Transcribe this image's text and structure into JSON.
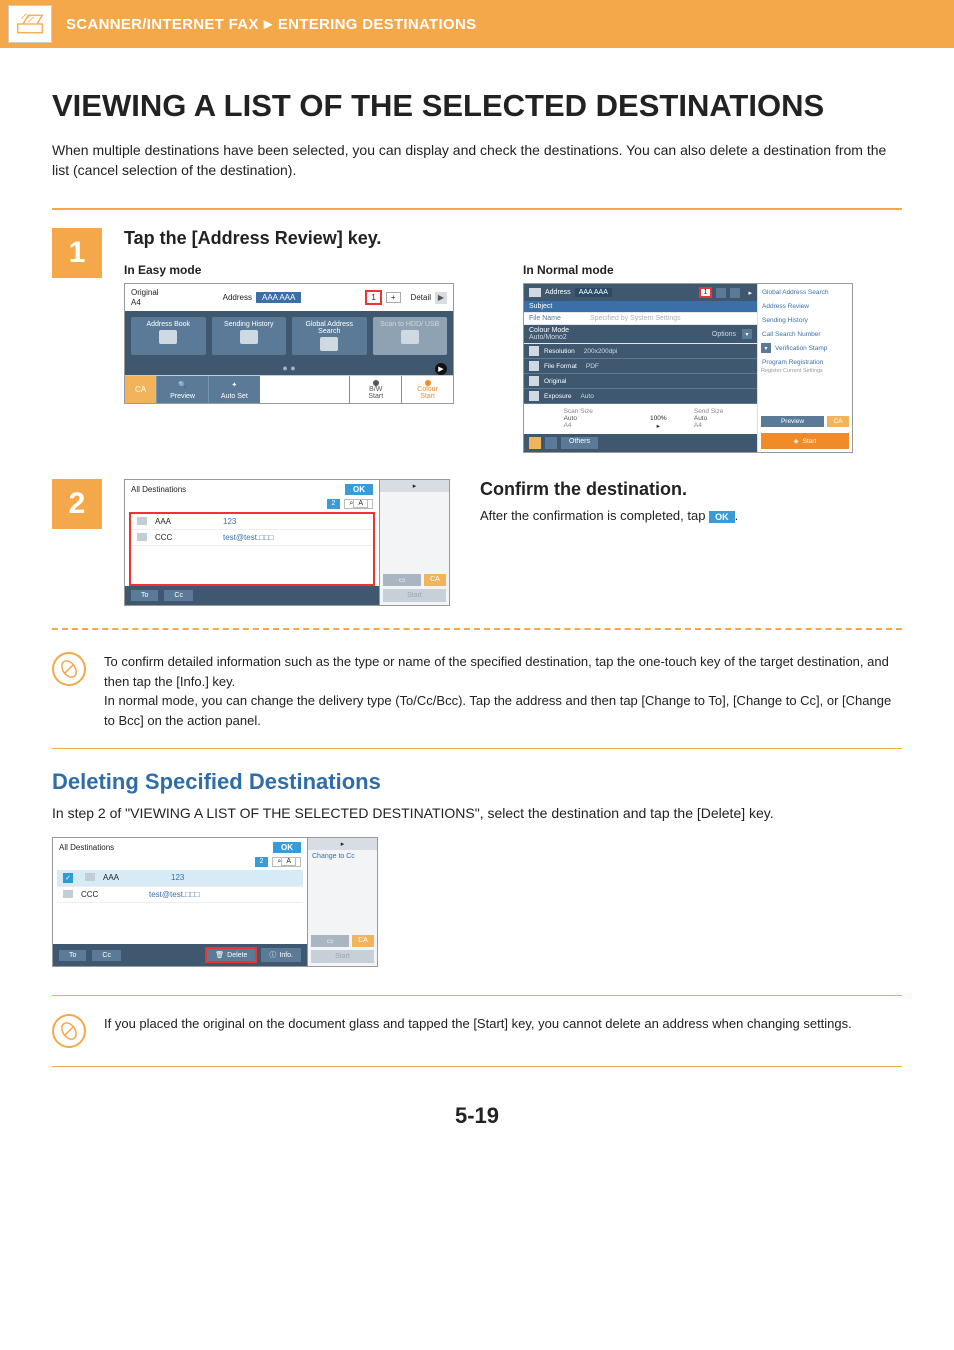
{
  "header": {
    "section": "SCANNER/INTERNET FAX",
    "subsection": "ENTERING DESTINATIONS"
  },
  "title": "VIEWING A LIST OF THE SELECTED DESTINATIONS",
  "intro": "When multiple destinations have been selected, you can display and check the destinations. You can also delete a destination from the list (cancel selection of the destination).",
  "step1": {
    "num": "1",
    "heading": "Tap the [Address Review] key.",
    "easy_label": "In Easy mode",
    "normal_label": "In Normal mode",
    "easy": {
      "original_label": "Original",
      "original_size": "A4",
      "address_label": "Address",
      "address_value": "AAA AAA",
      "count": "1",
      "plus": "+",
      "detail": "Detail",
      "btn_addressbook": "Address Book",
      "btn_history": "Sending History",
      "btn_global": "Global Address Search",
      "btn_usb": "Scan to HDD/ USB",
      "ca": "CA",
      "preview": "Preview",
      "autoset": "Auto Set",
      "bw": "B/W",
      "bw_start": "Start",
      "colour": "Colour",
      "colour_start": "Start"
    },
    "normal": {
      "address_label": "Address",
      "address_value": "AAA AAA",
      "count": "1",
      "subject": "Subject",
      "filename": "File Name",
      "filename_val": "Specified by System Settings",
      "colourmode": "Colour Mode",
      "colourmode_val": "Auto/Mono2",
      "options": "Options",
      "resolution": "Resolution",
      "resolution_val": "200x200dpi",
      "fileformat": "File Format",
      "fileformat_val": "PDF",
      "original": "Original",
      "exposure": "Exposure",
      "exposure_val": "Auto",
      "others": "Others",
      "scansize": "Scan Size",
      "scansize_val": "Auto",
      "scansize_fmt": "A4",
      "zoom": "100%",
      "sendsize": "Send Size",
      "sendsize_val": "Auto",
      "sendsize_fmt": "A4",
      "right_global": "Global Address Search",
      "right_review": "Address Review",
      "right_history": "Sending History",
      "right_call": "Call Search Number",
      "right_verify": "Verification Stamp",
      "right_program": "Program Registration",
      "right_program_sub": "Register Current Settings",
      "preview": "Preview",
      "ca": "CA",
      "start": "Start"
    }
  },
  "step2": {
    "num": "2",
    "all_dest": "All Destinations",
    "ok": "OK",
    "sort_num": "2",
    "sort_alpha": "A",
    "rows": [
      {
        "name": "AAA",
        "value": "123"
      },
      {
        "name": "CCC",
        "value": "test@test.□□□"
      }
    ],
    "to": "To",
    "cc": "Cc",
    "heading": "Confirm the destination.",
    "text_before": "After the confirmation is completed, tap ",
    "text_after": "."
  },
  "note1": "To confirm detailed information such as the type or name of the specified destination, tap the one-touch key of the target destination, and then tap the [Info.] key.\nIn normal mode, you can change the delivery type (To/Cc/Bcc). Tap the address and then tap [Change to To], [Change to Cc], or [Change to Bcc] on the action panel.",
  "section2": {
    "title": "Deleting Specified Destinations",
    "intro": "In step 2 of \"VIEWING A LIST OF THE SELECTED DESTINATIONS\", select the destination and tap the [Delete] key.",
    "all_dest": "All Destinations",
    "ok": "OK",
    "sort_num": "2",
    "sort_alpha": "A",
    "rows": [
      {
        "name": "AAA",
        "value": "123",
        "selected": true
      },
      {
        "name": "CCC",
        "value": "test@test.□□□",
        "selected": false
      }
    ],
    "to": "To",
    "cc": "Cc",
    "delete": "Delete",
    "info": "Info.",
    "side_change": "Change to Cc",
    "ca": "CA",
    "start": "Start"
  },
  "note2": "If you placed the original on the document glass and tapped the [Start] key, you cannot delete an address when changing settings.",
  "page_number": "5-19"
}
